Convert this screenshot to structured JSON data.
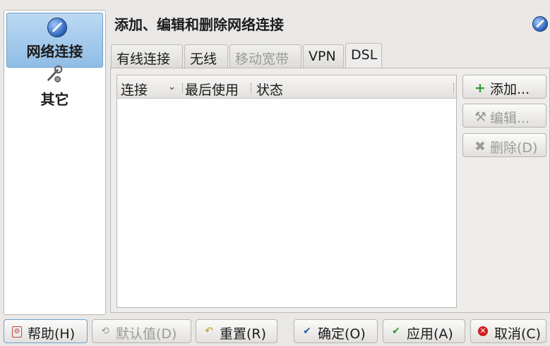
{
  "sidebar": {
    "items": [
      {
        "label": "网络连接",
        "icon": "network-icon"
      },
      {
        "label": "其它",
        "icon": "tools-icon"
      }
    ]
  },
  "header": {
    "title": "添加、编辑和删除网络连接",
    "icon": "network-icon"
  },
  "tabs": [
    {
      "label": "有线连接",
      "state": "normal"
    },
    {
      "label": "无线",
      "state": "normal"
    },
    {
      "label": "移动宽带",
      "state": "disabled"
    },
    {
      "label": "VPN",
      "state": "normal"
    },
    {
      "label": "DSL",
      "state": "active"
    }
  ],
  "table": {
    "columns": [
      "连接",
      "最后使用",
      "状态"
    ],
    "rows": []
  },
  "side_buttons": {
    "add": "添加...",
    "edit": "编辑...",
    "delete": "删除(D)"
  },
  "footer_buttons": {
    "help": "帮助(H)",
    "defaults": "默认值(D)",
    "reset": "重置(R)",
    "ok": "确定(O)",
    "apply": "应用(A)",
    "cancel": "取消(C)"
  },
  "colors": {
    "accent": "#8fbde6",
    "add_icon": "#2f9a2f",
    "ok_icon": "#2a5fa8",
    "apply_icon": "#2f9a2f",
    "cancel_icon": "#cc1f1f"
  }
}
